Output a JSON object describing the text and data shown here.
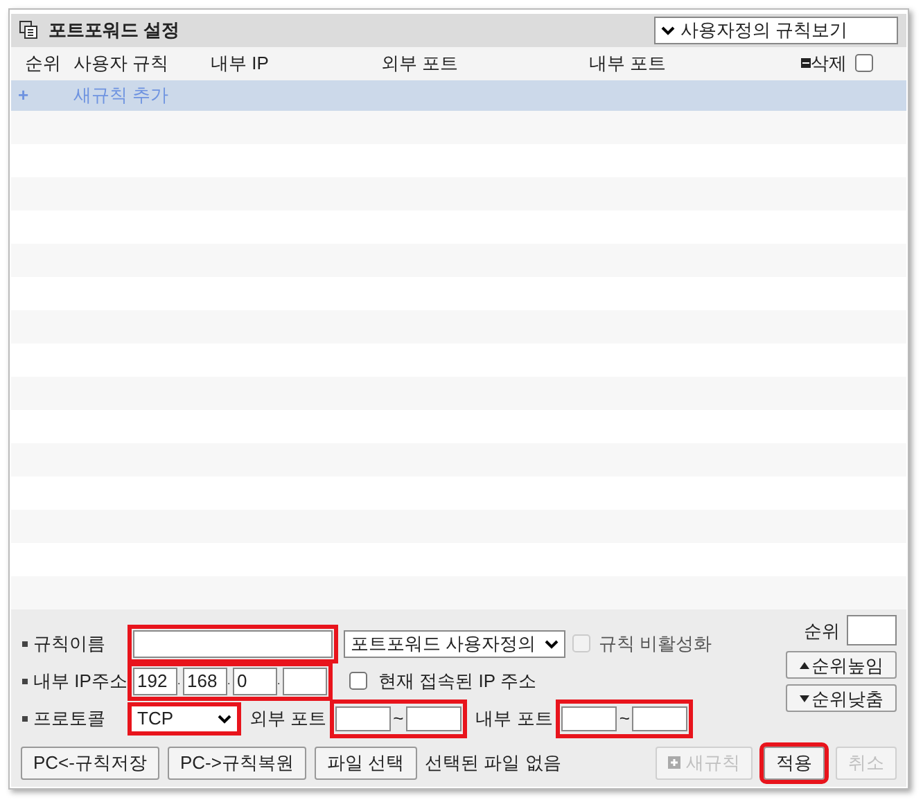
{
  "panel": {
    "title": "포트포워드 설정",
    "view_select": {
      "value": "사용자정의 규칙보기"
    }
  },
  "table": {
    "columns": [
      "순위",
      "사용자 규칙",
      "내부 IP",
      "외부 포트",
      "내부 포트"
    ],
    "delete_label": "삭제",
    "delete_all_checked": false,
    "add_row": {
      "icon": "+",
      "label": "새규칙 추가"
    }
  },
  "form": {
    "rule_name": {
      "label": "규칙이름",
      "highlighted": true
    },
    "preset": {
      "value": "포트포워드 사용자정의"
    },
    "disable_rule": {
      "label": "규칙 비활성화",
      "checked": false,
      "disabled": true
    },
    "internal_ip": {
      "label": "내부 IP주소",
      "octets": [
        "192",
        "168",
        "0"
      ],
      "separator": ".",
      "highlighted": true
    },
    "current_ip": {
      "label": "현재 접속된 IP 주소",
      "checked": false
    },
    "protocol": {
      "label": "프로토콜",
      "value": "TCP",
      "highlighted": true
    },
    "external_port": {
      "label": "외부 포트",
      "separator": "~",
      "highlighted": true
    },
    "internal_port": {
      "label": "내부 포트",
      "separator": "~",
      "highlighted": true
    },
    "rank": {
      "label": "순위"
    },
    "rank_up": "순위높임",
    "rank_down": "순위낮춤"
  },
  "buttons": [
    {
      "label": "PC<-규칙저장",
      "disabled": false,
      "highlighted": false
    },
    {
      "label": "PC->규칙복원",
      "disabled": false,
      "highlighted": false
    },
    {
      "label": "파일 선택",
      "disabled": false,
      "highlighted": false
    }
  ],
  "file_status": "선택된 파일 없음",
  "actions": [
    {
      "label": "새규칙",
      "icon": true,
      "disabled": true,
      "highlighted": false
    },
    {
      "label": "적용",
      "disabled": false,
      "highlighted": true
    },
    {
      "label": "취소",
      "disabled": true,
      "highlighted": false
    }
  ]
}
